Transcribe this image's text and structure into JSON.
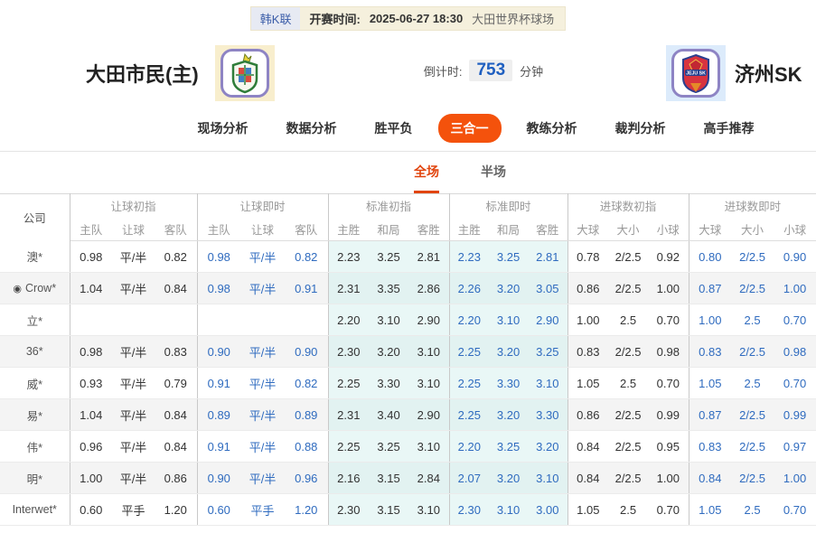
{
  "colors": {
    "accent_orange": "#f4520c",
    "subtab_red": "#e1450f",
    "live_blue": "#2f6bbf",
    "cyan_bg": "#e9f7f6",
    "topbar_beige": "#f5f0dd"
  },
  "top_bar": {
    "league": "韩K联",
    "kickoff_label": "开赛时间:",
    "kickoff_time": "2025-06-27 18:30",
    "venue": "大田世界杯球场"
  },
  "match": {
    "home_name": "大田市民(主)",
    "away_name": "济州SK",
    "countdown_label": "倒计时:",
    "countdown_value": "753",
    "countdown_unit": "分钟"
  },
  "nav": {
    "items": [
      "现场分析",
      "数据分析",
      "胜平负",
      "三合一",
      "教练分析",
      "裁判分析",
      "高手推荐"
    ],
    "active_index": 3
  },
  "subtabs": {
    "items": [
      "全场",
      "半场"
    ],
    "active_index": 0
  },
  "table": {
    "company_header": "公司",
    "groups": [
      {
        "label": "让球初指",
        "cols": [
          "主队",
          "让球",
          "客队"
        ]
      },
      {
        "label": "让球即时",
        "cols": [
          "主队",
          "让球",
          "客队"
        ]
      },
      {
        "label": "标准初指",
        "cols": [
          "主胜",
          "和局",
          "客胜"
        ]
      },
      {
        "label": "标准即时",
        "cols": [
          "主胜",
          "和局",
          "客胜"
        ]
      },
      {
        "label": "进球数初指",
        "cols": [
          "大球",
          "大小",
          "小球"
        ]
      },
      {
        "label": "进球数即时",
        "cols": [
          "大球",
          "大小",
          "小球"
        ]
      }
    ],
    "rows": [
      {
        "company": "澳*",
        "icon": false,
        "cells": [
          [
            "0.98",
            "平/半",
            "0.82"
          ],
          [
            "0.98",
            "平/半",
            "0.82"
          ],
          [
            "2.23",
            "3.25",
            "2.81"
          ],
          [
            "2.23",
            "3.25",
            "2.81"
          ],
          [
            "0.78",
            "2/2.5",
            "0.92"
          ],
          [
            "0.80",
            "2/2.5",
            "0.90"
          ]
        ]
      },
      {
        "company": "Crow*",
        "icon": true,
        "cells": [
          [
            "1.04",
            "平/半",
            "0.84"
          ],
          [
            "0.98",
            "平/半",
            "0.91"
          ],
          [
            "2.31",
            "3.35",
            "2.86"
          ],
          [
            "2.26",
            "3.20",
            "3.05"
          ],
          [
            "0.86",
            "2/2.5",
            "1.00"
          ],
          [
            "0.87",
            "2/2.5",
            "1.00"
          ]
        ]
      },
      {
        "company": "立*",
        "icon": false,
        "cells": [
          [
            "",
            "",
            ""
          ],
          [
            "",
            "",
            ""
          ],
          [
            "2.20",
            "3.10",
            "2.90"
          ],
          [
            "2.20",
            "3.10",
            "2.90"
          ],
          [
            "1.00",
            "2.5",
            "0.70"
          ],
          [
            "1.00",
            "2.5",
            "0.70"
          ]
        ]
      },
      {
        "company": "36*",
        "icon": false,
        "cells": [
          [
            "0.98",
            "平/半",
            "0.83"
          ],
          [
            "0.90",
            "平/半",
            "0.90"
          ],
          [
            "2.30",
            "3.20",
            "3.10"
          ],
          [
            "2.25",
            "3.20",
            "3.25"
          ],
          [
            "0.83",
            "2/2.5",
            "0.98"
          ],
          [
            "0.83",
            "2/2.5",
            "0.98"
          ]
        ]
      },
      {
        "company": "威*",
        "icon": false,
        "cells": [
          [
            "0.93",
            "平/半",
            "0.79"
          ],
          [
            "0.91",
            "平/半",
            "0.82"
          ],
          [
            "2.25",
            "3.30",
            "3.10"
          ],
          [
            "2.25",
            "3.30",
            "3.10"
          ],
          [
            "1.05",
            "2.5",
            "0.70"
          ],
          [
            "1.05",
            "2.5",
            "0.70"
          ]
        ]
      },
      {
        "company": "易*",
        "icon": false,
        "cells": [
          [
            "1.04",
            "平/半",
            "0.84"
          ],
          [
            "0.89",
            "平/半",
            "0.89"
          ],
          [
            "2.31",
            "3.40",
            "2.90"
          ],
          [
            "2.25",
            "3.20",
            "3.30"
          ],
          [
            "0.86",
            "2/2.5",
            "0.99"
          ],
          [
            "0.87",
            "2/2.5",
            "0.99"
          ]
        ]
      },
      {
        "company": "伟*",
        "icon": false,
        "cells": [
          [
            "0.96",
            "平/半",
            "0.84"
          ],
          [
            "0.91",
            "平/半",
            "0.88"
          ],
          [
            "2.25",
            "3.25",
            "3.10"
          ],
          [
            "2.20",
            "3.25",
            "3.20"
          ],
          [
            "0.84",
            "2/2.5",
            "0.95"
          ],
          [
            "0.83",
            "2/2.5",
            "0.97"
          ]
        ]
      },
      {
        "company": "明*",
        "icon": false,
        "cells": [
          [
            "1.00",
            "平/半",
            "0.86"
          ],
          [
            "0.90",
            "平/半",
            "0.96"
          ],
          [
            "2.16",
            "3.15",
            "2.84"
          ],
          [
            "2.07",
            "3.20",
            "3.10"
          ],
          [
            "0.84",
            "2/2.5",
            "1.00"
          ],
          [
            "0.84",
            "2/2.5",
            "1.00"
          ]
        ]
      },
      {
        "company": "Interwet*",
        "icon": false,
        "cells": [
          [
            "0.60",
            "平手",
            "1.20"
          ],
          [
            "0.60",
            "平手",
            "1.20"
          ],
          [
            "2.30",
            "3.15",
            "3.10"
          ],
          [
            "2.30",
            "3.10",
            "3.00"
          ],
          [
            "1.05",
            "2.5",
            "0.70"
          ],
          [
            "1.05",
            "2.5",
            "0.70"
          ]
        ]
      }
    ]
  }
}
